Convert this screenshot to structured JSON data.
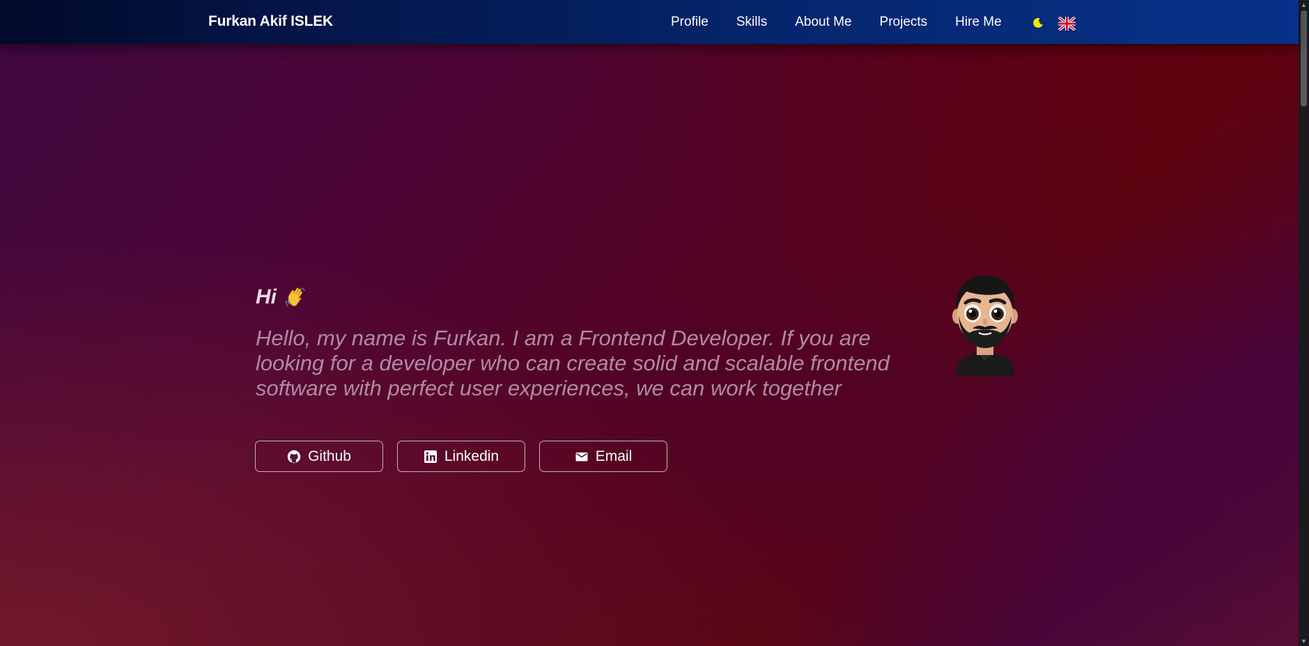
{
  "header": {
    "brand": "Furkan Akif ISLEK",
    "nav": [
      "Profile",
      "Skills",
      "About Me",
      "Projects",
      "Hire Me"
    ],
    "theme_icon": "moon-icon",
    "language_icon": "uk-flag-icon"
  },
  "hero": {
    "greeting": "Hi",
    "greeting_emoji": "waving-hand-icon",
    "intro": "Hello, my name is Furkan. I am a Frontend Developer. If you are looking for a developer who can create solid and scalable frontend software with perfect user experiences, we can work together",
    "buttons": [
      {
        "label": "Github",
        "icon": "github-icon"
      },
      {
        "label": "Linkedin",
        "icon": "linkedin-icon"
      },
      {
        "label": "Email",
        "icon": "email-icon"
      }
    ],
    "avatar_icon": "memoji-avatar"
  },
  "colors": {
    "nav_start": "#020a2a",
    "nav_end": "#07318a",
    "background_primary": "#4d0535",
    "background_secondary": "#5a0513",
    "intro_text": "#b08aa8",
    "moon": "#f5e600"
  }
}
